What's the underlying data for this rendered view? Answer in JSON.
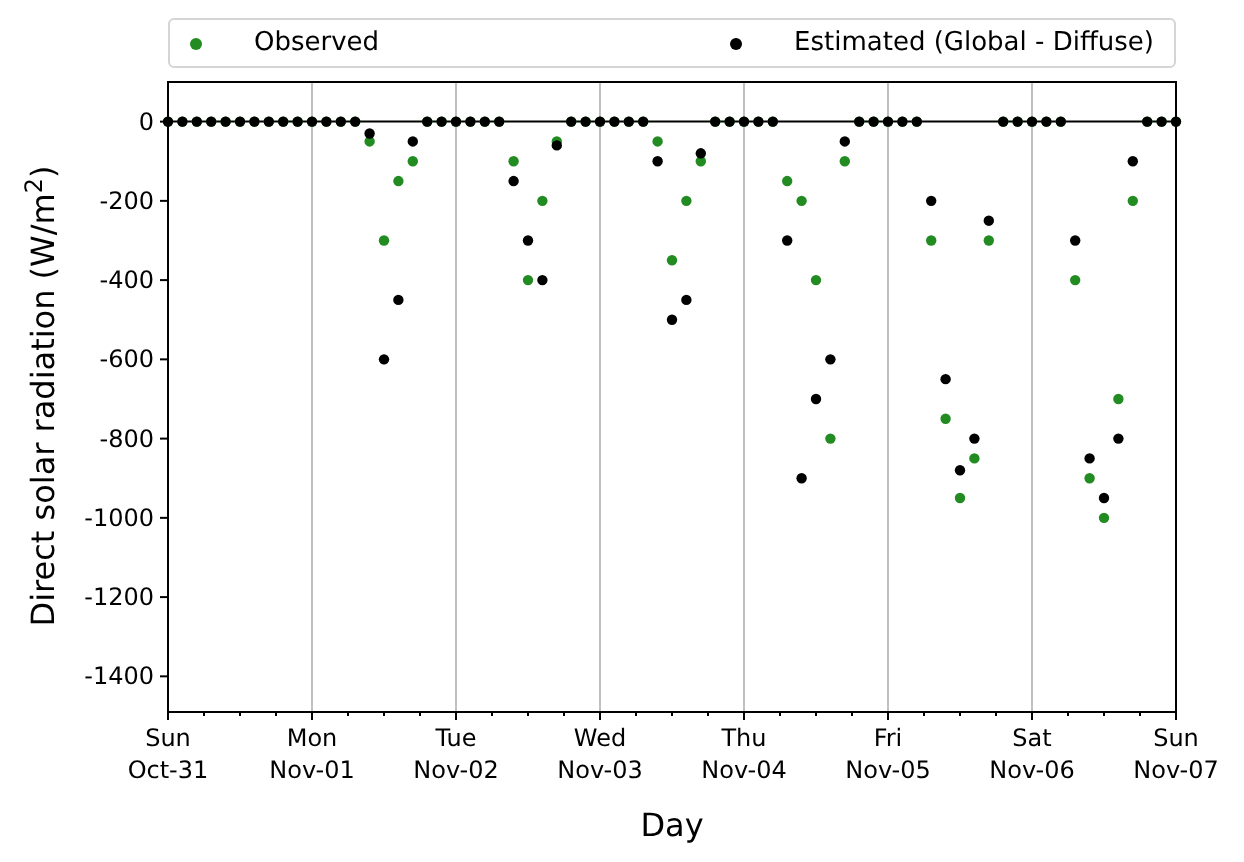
{
  "chart_data": {
    "type": "scatter",
    "grid": "x",
    "xlabel": "Day",
    "ylabel": "Direct solar radiation (W/m$^{2}$)",
    "ylim": [
      -1490,
      100
    ],
    "categories": [
      "Sun Oct-31",
      null,
      null,
      null,
      null,
      null,
      null,
      null,
      null,
      null,
      "Mon Nov-01",
      null,
      null,
      null,
      null,
      null,
      null,
      null,
      null,
      null,
      "Tue Nov-02",
      null,
      null,
      null,
      null,
      null,
      null,
      null,
      null,
      null,
      "Wed Nov-03",
      null,
      null,
      null,
      null,
      null,
      null,
      null,
      null,
      null,
      "Thu Nov-04",
      null,
      null,
      null,
      null,
      null,
      null,
      null,
      null,
      null,
      "Fri Nov-05",
      null,
      null,
      null,
      null,
      null,
      null,
      null,
      null,
      null,
      "Sat Nov-06",
      null,
      null,
      null,
      null,
      null,
      null,
      null,
      null,
      null,
      "Sun Nov-07"
    ],
    "series": [
      {
        "name": "Observed",
        "color": "#228b22",
        "values": [
          0,
          0,
          0,
          0,
          0,
          0,
          0,
          0,
          0,
          0,
          0,
          0,
          0,
          0,
          -50,
          -300,
          -150,
          -100,
          0,
          0,
          0,
          0,
          0,
          0,
          -100,
          -400,
          -200,
          -50,
          0,
          0,
          0,
          0,
          0,
          0,
          -50,
          -350,
          -200,
          -100,
          0,
          0,
          0,
          0,
          0,
          -150,
          -200,
          -400,
          -800,
          -100,
          0,
          0,
          0,
          0,
          0,
          -300,
          -750,
          -950,
          -850,
          -300,
          0,
          0,
          0,
          0,
          0,
          -400,
          -900,
          -1000,
          -700,
          -200,
          0,
          0,
          0
        ]
      },
      {
        "name": "Estimated (Global - Diffuse)",
        "color": "#000000",
        "values": [
          0,
          0,
          0,
          0,
          0,
          0,
          0,
          0,
          0,
          0,
          0,
          0,
          0,
          0,
          -30,
          -600,
          -450,
          -50,
          0,
          0,
          0,
          0,
          0,
          0,
          -150,
          -300,
          -400,
          -60,
          0,
          0,
          0,
          0,
          0,
          0,
          -100,
          -500,
          -450,
          -80,
          0,
          0,
          0,
          0,
          0,
          -300,
          -900,
          -700,
          -600,
          -50,
          0,
          0,
          0,
          0,
          0,
          -200,
          -650,
          -880,
          -800,
          -250,
          0,
          0,
          0,
          0,
          0,
          -300,
          -850,
          -950,
          -800,
          -100,
          0,
          0,
          0
        ]
      }
    ],
    "yticks": [
      0,
      -200,
      -400,
      -600,
      -800,
      -1000,
      -1200,
      -1400
    ]
  }
}
